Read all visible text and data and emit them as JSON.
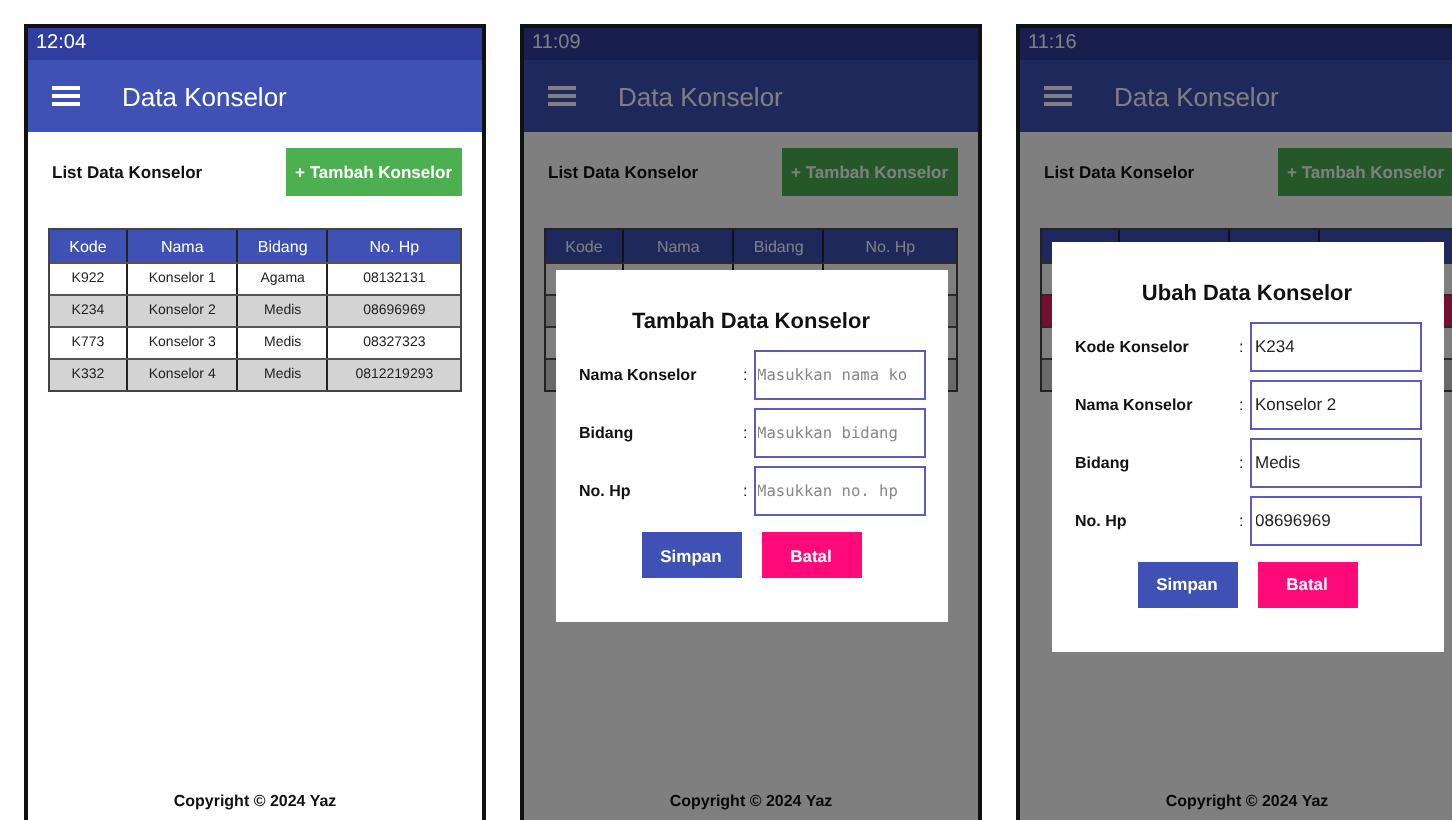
{
  "phones": [
    {
      "status_time": "12:04",
      "title": "Data Konselor",
      "list_label": "List Data Konselor",
      "add_button": "+ Tambah Konselor",
      "table": {
        "columns": [
          "Kode",
          "Nama",
          "Bidang",
          "No. Hp"
        ],
        "rows": [
          {
            "selected": false,
            "cells": [
              "K922",
              "Konselor 1",
              "Agama",
              "08132131"
            ]
          },
          {
            "selected": false,
            "cells": [
              "K234",
              "Konselor 2",
              "Medis",
              "08696969"
            ]
          },
          {
            "selected": false,
            "cells": [
              "K773",
              "Konselor 3",
              "Medis",
              "08327323"
            ]
          },
          {
            "selected": false,
            "cells": [
              "K332",
              "Konselor 4",
              "Medis",
              "0812219293"
            ]
          }
        ]
      },
      "footer": "Copyright © 2024 Yaz"
    },
    {
      "status_time": "11:09",
      "title": "Data Konselor",
      "list_label": "List Data Konselor",
      "add_button": "+ Tambah Konselor",
      "table": {
        "columns": [
          "Kode",
          "Nama",
          "Bidang",
          "No. Hp"
        ],
        "rows": [
          {
            "selected": false
          },
          {
            "selected": false
          },
          {
            "selected": false
          },
          {
            "selected": false
          }
        ]
      },
      "dialog": {
        "title": "Tambah Data Konselor",
        "fields": [
          {
            "label": "Nama Konselor",
            "separator": ":",
            "placeholder": "Masukkan nama ko"
          },
          {
            "label": "Bidang",
            "separator": ":",
            "placeholder": "Masukkan bidang"
          },
          {
            "label": "No. Hp",
            "separator": ":",
            "placeholder": "Masukkan no. hp"
          }
        ],
        "save_button": "Simpan",
        "cancel_button": "Batal"
      },
      "footer": "Copyright © 2024 Yaz"
    },
    {
      "status_time": "11:16",
      "title": "Data Konselor",
      "list_label": "List Data Konselor",
      "add_button": "+ Tambah Konselor",
      "table": {
        "rows": [
          {
            "selected": false
          },
          {
            "selected": true
          },
          {
            "selected": false
          },
          {
            "selected": false
          }
        ]
      },
      "dialog": {
        "title": "Ubah Data Konselor",
        "fields": [
          {
            "label": "Kode Konselor",
            "separator": ":",
            "value": "K234"
          },
          {
            "label": "Nama Konselor",
            "separator": ":",
            "value": "Konselor 2"
          },
          {
            "label": "Bidang",
            "separator": ":",
            "value": "Medis"
          },
          {
            "label": "No. Hp",
            "separator": ":",
            "value": "08696969"
          }
        ],
        "save_button": "Simpan",
        "cancel_button": "Batal"
      },
      "footer": "Copyright © 2024 Yaz"
    }
  ]
}
